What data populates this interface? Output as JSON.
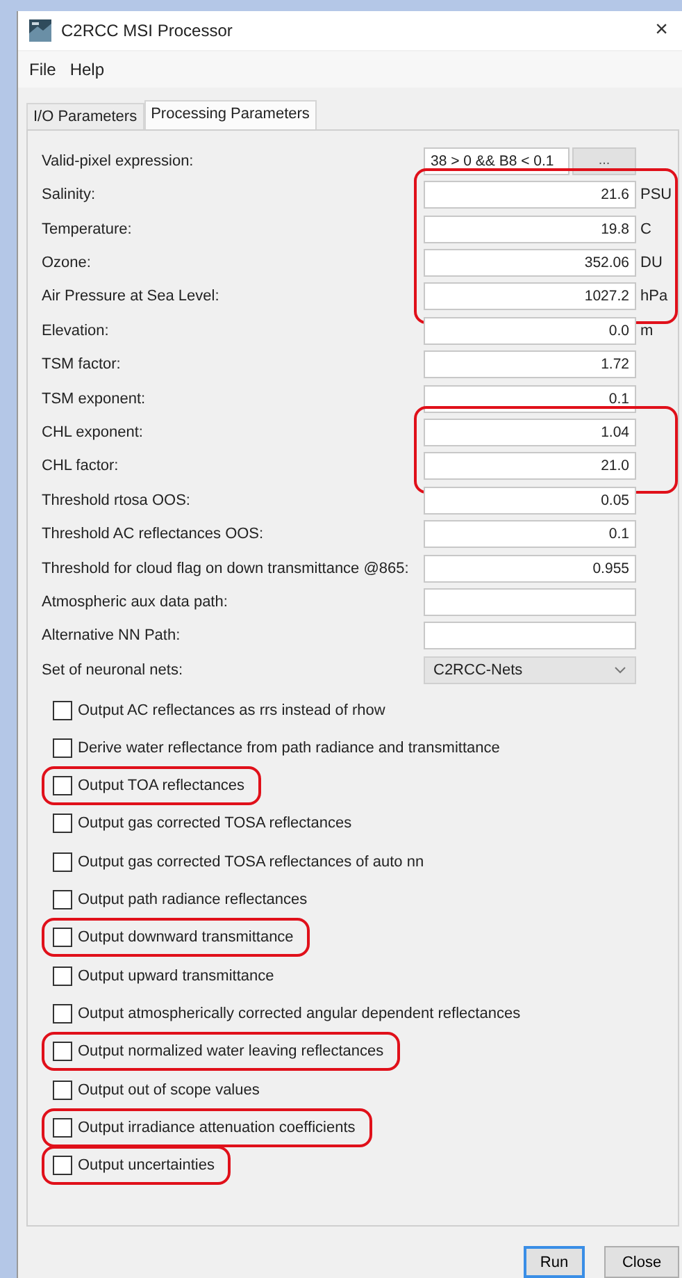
{
  "window": {
    "title": "C2RCC MSI Processor",
    "close": "×"
  },
  "menu": [
    "File",
    "Help"
  ],
  "tabs": [
    {
      "label": "I/O Parameters",
      "selected": false
    },
    {
      "label": "Processing Parameters",
      "selected": true
    }
  ],
  "params": [
    {
      "kind": "expression",
      "label": "Valid-pixel expression:",
      "value": "38 > 0 && B8 < 0.1",
      "button": "...",
      "highlighted": false
    },
    {
      "kind": "number",
      "label": "Salinity:",
      "value": "21.6",
      "unit": "PSU",
      "highlighted": true
    },
    {
      "kind": "number",
      "label": "Temperature:",
      "value": "19.8",
      "unit": "C",
      "highlighted": true
    },
    {
      "kind": "number",
      "label": "Ozone:",
      "value": "352.06",
      "unit": "DU",
      "highlighted": true
    },
    {
      "kind": "number",
      "label": "Air Pressure at Sea Level:",
      "value": "1027.2",
      "unit": "hPa",
      "highlighted": true
    },
    {
      "kind": "number",
      "label": "Elevation:",
      "value": "0.0",
      "unit": "m",
      "highlighted": false
    },
    {
      "kind": "number",
      "label": "TSM factor:",
      "value": "1.72",
      "highlighted": false
    },
    {
      "kind": "number",
      "label": "TSM exponent:",
      "value": "0.1",
      "highlighted": false
    },
    {
      "kind": "number",
      "label": "CHL exponent:",
      "value": "1.04",
      "highlighted": true
    },
    {
      "kind": "number",
      "label": "CHL factor:",
      "value": "21.0",
      "highlighted": true
    },
    {
      "kind": "number",
      "label": "Threshold rtosa OOS:",
      "value": "0.05",
      "highlighted": false
    },
    {
      "kind": "number",
      "label": "Threshold AC reflectances OOS:",
      "value": "0.1",
      "highlighted": false
    },
    {
      "kind": "number",
      "label": "Threshold for cloud flag on down transmittance @865:",
      "value": "0.955",
      "highlighted": false
    },
    {
      "kind": "text",
      "label": "Atmospheric aux data path:",
      "highlighted": false
    },
    {
      "kind": "text",
      "label": "Alternative NN Path:",
      "highlighted": false
    },
    {
      "kind": "dropdown",
      "label": "Set of neuronal nets:",
      "value": "C2RCC-Nets",
      "highlighted": false
    }
  ],
  "options": [
    {
      "label": "Output AC reflectances as rrs instead of rhow",
      "checked": false,
      "highlighted": false
    },
    {
      "label": "Derive water reflectance from path radiance and transmittance",
      "checked": false,
      "highlighted": false
    },
    {
      "label": "Output TOA reflectances",
      "checked": false,
      "highlighted": true
    },
    {
      "label": "Output gas corrected TOSA reflectances",
      "checked": false,
      "highlighted": false
    },
    {
      "label": "Output gas corrected TOSA reflectances of auto nn",
      "checked": false,
      "highlighted": false
    },
    {
      "label": "Output path radiance reflectances",
      "checked": false,
      "highlighted": false
    },
    {
      "label": "Output downward transmittance",
      "checked": false,
      "highlighted": true
    },
    {
      "label": "Output upward transmittance",
      "checked": false,
      "highlighted": false
    },
    {
      "label": "Output atmospherically corrected angular dependent reflectances",
      "checked": false,
      "highlighted": false
    },
    {
      "label": "Output normalized water leaving reflectances",
      "checked": false,
      "highlighted": true
    },
    {
      "label": "Output out of scope values",
      "checked": false,
      "highlighted": false
    },
    {
      "label": "Output irradiance attenuation coefficients",
      "checked": false,
      "highlighted": true
    },
    {
      "label": "Output uncertainties",
      "checked": false,
      "highlighted": true
    }
  ],
  "buttons": [
    {
      "label": "Run",
      "kind": "default"
    },
    {
      "label": "Close",
      "kind": "normal"
    }
  ]
}
